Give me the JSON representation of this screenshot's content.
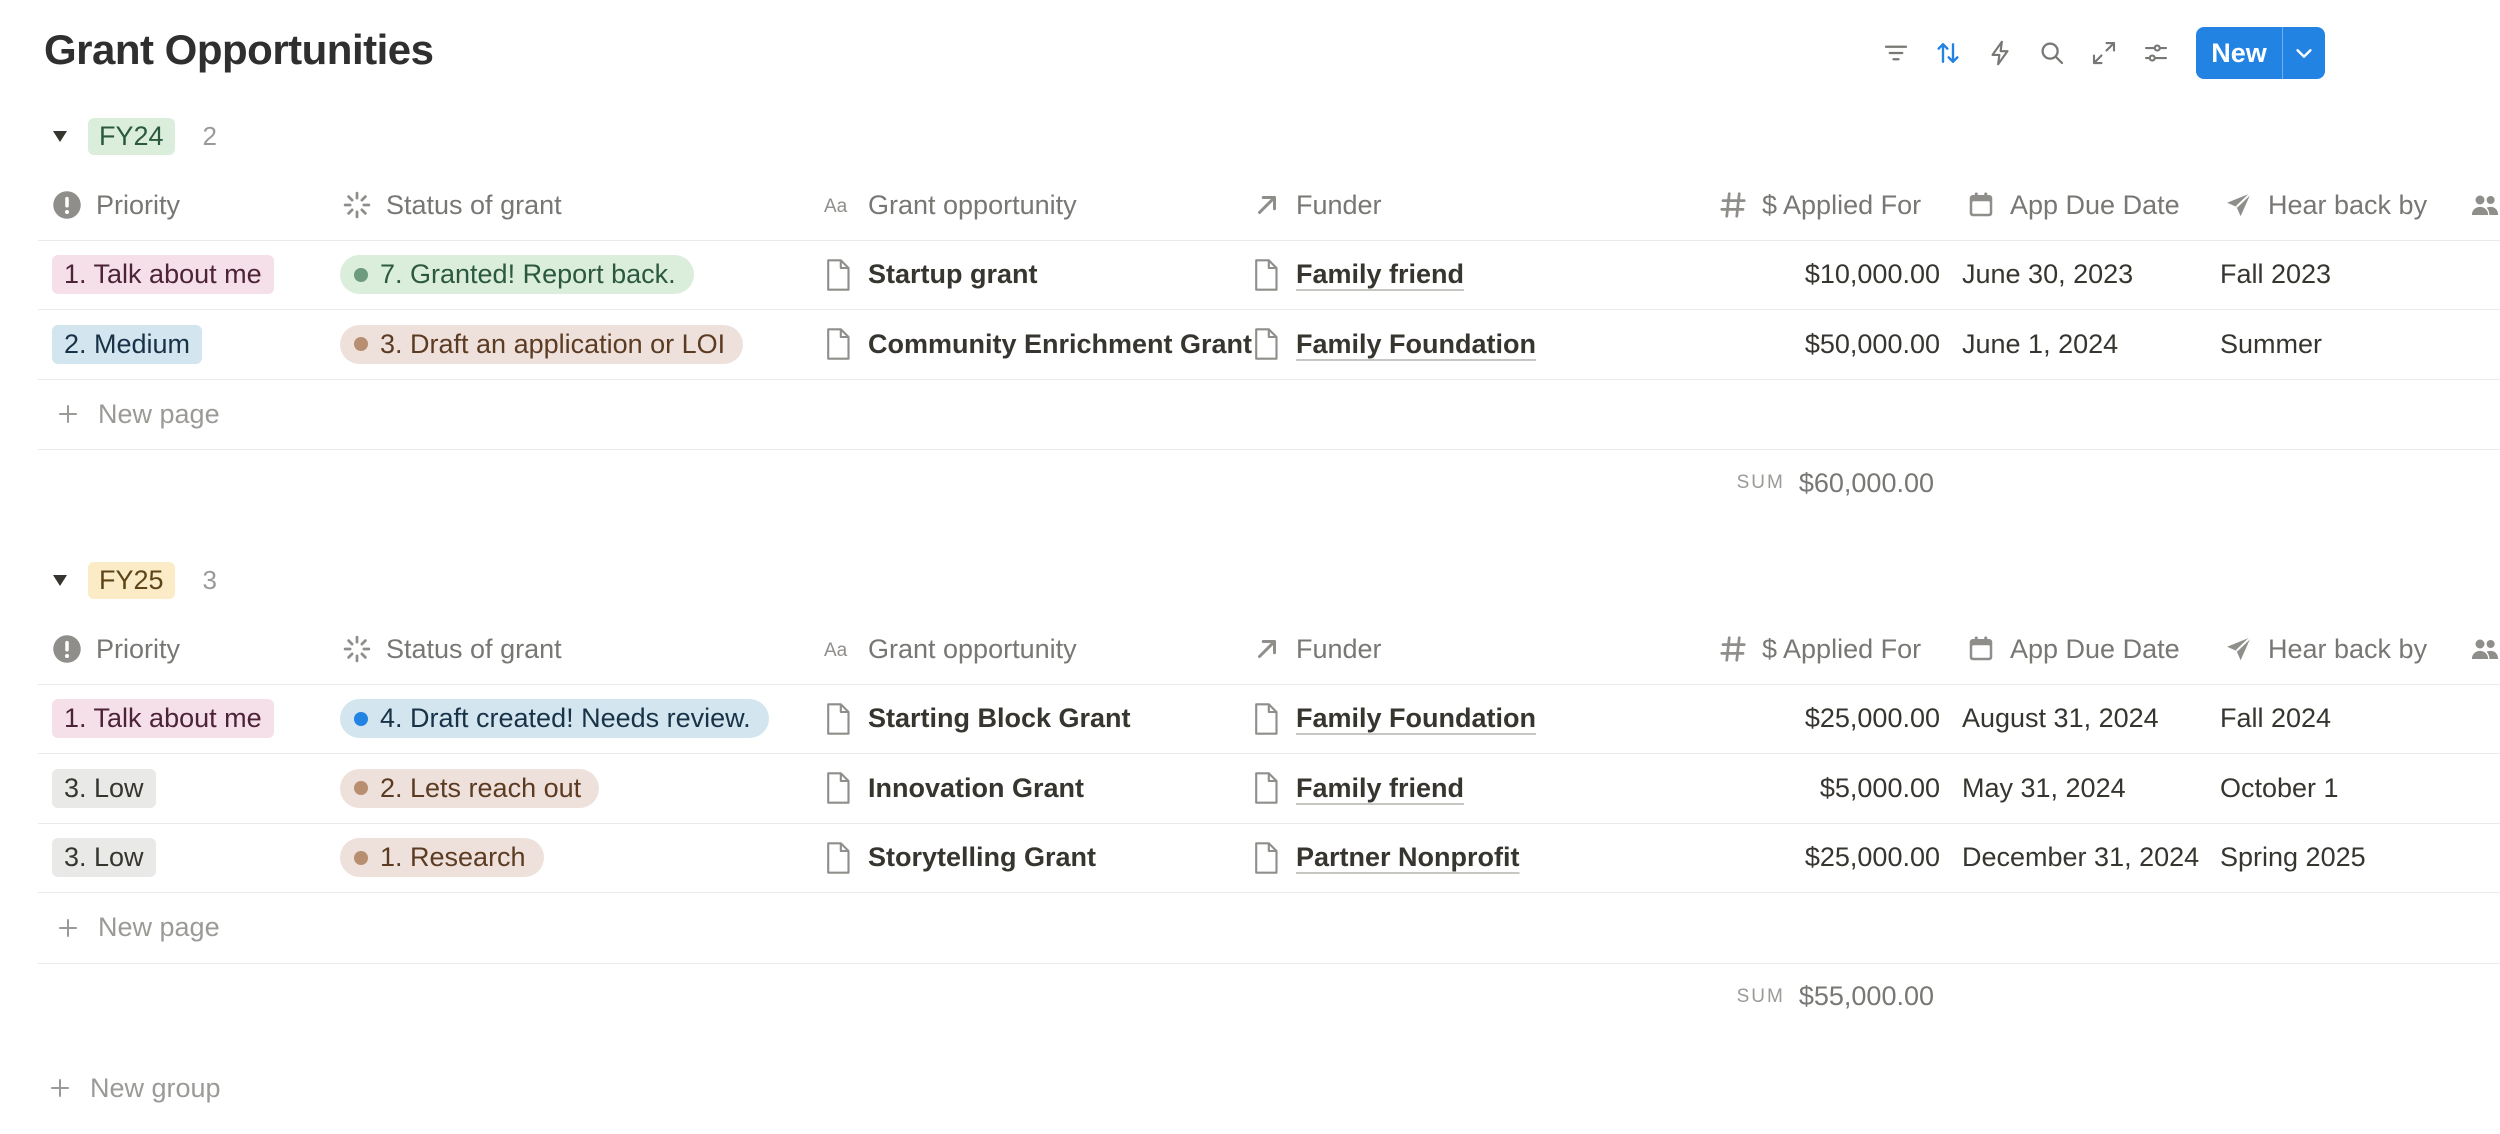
{
  "title": "Grant Opportunities",
  "toolbar": {
    "icons": [
      "filter-icon",
      "sort-icon",
      "automation-icon",
      "search-icon",
      "expand-icon",
      "settings-icon"
    ],
    "new_label": "New",
    "accent": "#2383e2"
  },
  "columns": {
    "priority": "Priority",
    "status": "Status of grant",
    "opportunity": "Grant opportunity",
    "funder": "Funder",
    "applied": "$ Applied For",
    "due": "App Due Date",
    "hear": "Hear back by"
  },
  "new_page_label": "New page",
  "sum_label": "SUM",
  "new_group_label": "New group",
  "groups": [
    {
      "name": "FY24",
      "count": "2",
      "badge_bg": "#dbeddb",
      "badge_fg": "#2b593f",
      "sum": "$60,000.00",
      "rows": [
        {
          "priority": "1. Talk about me",
          "priority_bg": "#f5e0e9",
          "priority_fg": "#4c2337",
          "status": "7. Granted! Report back.",
          "status_bg": "#dbeddb",
          "status_fg": "#2b593f",
          "status_dot": "#6c9b7d",
          "opportunity": "Startup grant",
          "funder": "Family friend",
          "applied": "$10,000.00",
          "due": "June 30, 2023",
          "hear": "Fall 2023"
        },
        {
          "priority": "2. Medium",
          "priority_bg": "#d3e5ef",
          "priority_fg": "#183347",
          "status": "3. Draft an application or LOI",
          "status_bg": "#eee0da",
          "status_fg": "#5c3b23",
          "status_dot": "#b88e70",
          "opportunity": "Community Enrichment Grant",
          "funder": "Family Foundation",
          "applied": "$50,000.00",
          "due": "June 1, 2024",
          "hear": "Summer"
        }
      ]
    },
    {
      "name": "FY25",
      "count": "3",
      "badge_bg": "#fbecc7",
      "badge_fg": "#5d4419",
      "sum": "$55,000.00",
      "rows": [
        {
          "priority": "1. Talk about me",
          "priority_bg": "#f5e0e9",
          "priority_fg": "#4c2337",
          "status": "4. Draft created! Needs review.",
          "status_bg": "#d3e5ef",
          "status_fg": "#183347",
          "status_dot": "#2383e2",
          "opportunity": "Starting Block Grant",
          "funder": "Family Foundation",
          "applied": "$25,000.00",
          "due": "August 31, 2024",
          "hear": "Fall 2024"
        },
        {
          "priority": "3. Low",
          "priority_bg": "#e9e9e7",
          "priority_fg": "#37352f",
          "status": "2. Lets reach out",
          "status_bg": "#eee0da",
          "status_fg": "#5c3b23",
          "status_dot": "#b88e70",
          "opportunity": "Innovation Grant",
          "funder": "Family friend",
          "applied": "$5,000.00",
          "due": "May 31, 2024",
          "hear": "October 1"
        },
        {
          "priority": "3. Low",
          "priority_bg": "#e9e9e7",
          "priority_fg": "#37352f",
          "status": "1. Research",
          "status_bg": "#eee0da",
          "status_fg": "#5c3b23",
          "status_dot": "#b88e70",
          "opportunity": "Storytelling Grant",
          "funder": "Partner Nonprofit",
          "applied": "$25,000.00",
          "due": "December 31, 2024",
          "hear": "Spring 2025"
        }
      ]
    }
  ]
}
